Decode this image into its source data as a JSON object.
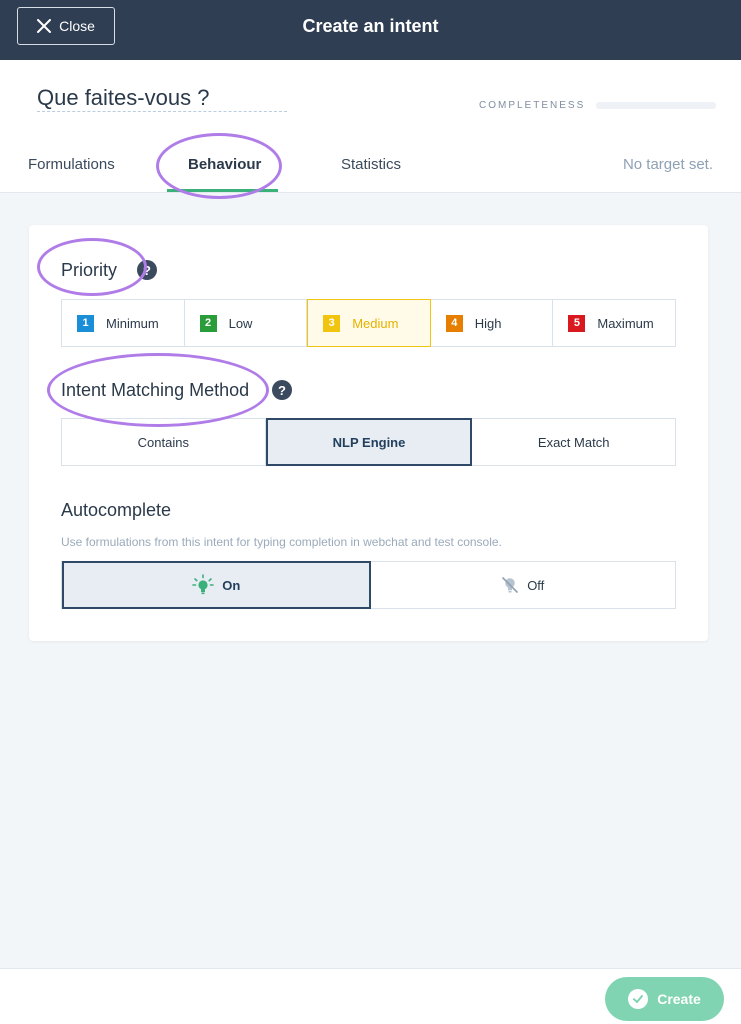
{
  "topbar": {
    "close_label": "Close",
    "title": "Create an intent"
  },
  "intent": {
    "name": "Que faites-vous ?"
  },
  "completeness": {
    "label": "COMPLETENESS",
    "value": 0
  },
  "tabs": [
    {
      "label": "Formulations",
      "active": false
    },
    {
      "label": "Behaviour",
      "active": true
    },
    {
      "label": "Statistics",
      "active": false
    }
  ],
  "target_status": "No target set.",
  "priority": {
    "title": "Priority",
    "help": "?",
    "options": [
      {
        "num": "1",
        "label": "Minimum",
        "color": "#1a8fd8"
      },
      {
        "num": "2",
        "label": "Low",
        "color": "#2a9d3a"
      },
      {
        "num": "3",
        "label": "Medium",
        "color": "#f1c40f"
      },
      {
        "num": "4",
        "label": "High",
        "color": "#e67e00"
      },
      {
        "num": "5",
        "label": "Maximum",
        "color": "#d9181f"
      }
    ],
    "selected": "Medium"
  },
  "matching": {
    "title": "Intent Matching Method",
    "help": "?",
    "options": [
      "Contains",
      "NLP Engine",
      "Exact Match"
    ],
    "selected": "NLP Engine"
  },
  "autocomplete": {
    "title": "Autocomplete",
    "description": "Use formulations from this intent for typing completion in webchat and test console.",
    "on_label": "On",
    "off_label": "Off",
    "selected": "On"
  },
  "footer": {
    "create_label": "Create"
  },
  "colors": {
    "topbar": "#2f3e52",
    "accent_green": "#3ab07a",
    "create_button": "#80d4b2",
    "highlight": "#b07de8"
  }
}
